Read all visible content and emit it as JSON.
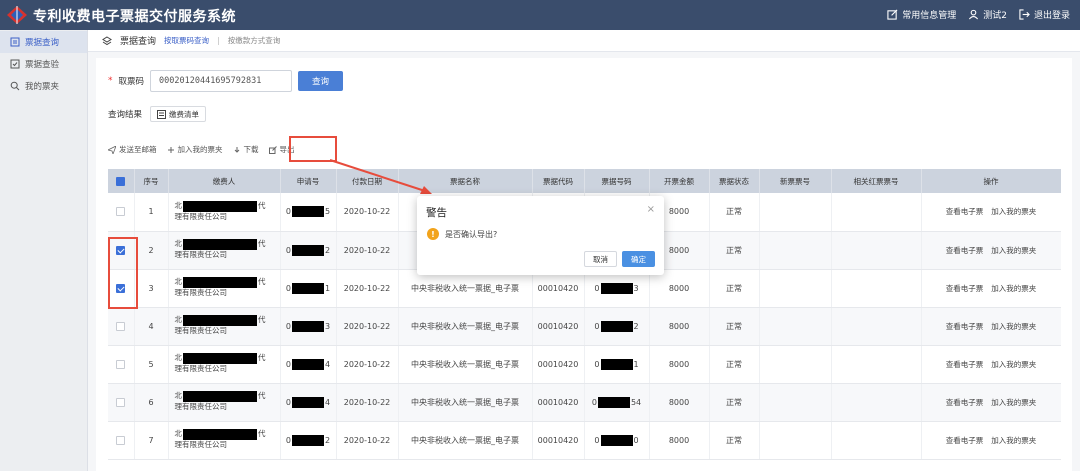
{
  "app": {
    "title": "专利收费电子票据交付服务系统"
  },
  "topbar": {
    "actions": [
      {
        "label": "常用信息管理",
        "icon": "edit-icon"
      },
      {
        "label": "测试2",
        "icon": "user-icon"
      },
      {
        "label": "退出登录",
        "icon": "logout-icon"
      }
    ]
  },
  "sidebar": {
    "items": [
      {
        "label": "票据查询",
        "icon": "document-icon",
        "active": true
      },
      {
        "label": "票据查验",
        "icon": "check-icon",
        "active": false
      },
      {
        "label": "我的票夹",
        "icon": "search-icon",
        "active": false
      }
    ]
  },
  "breadcrumb": {
    "main": "票据查询",
    "tabs": [
      "按取票码查询",
      "按缴款方式查询"
    ],
    "separator": "|"
  },
  "search": {
    "required_mark": "*",
    "label": "取票码",
    "value": "00020120441695792831",
    "button": "查询"
  },
  "result": {
    "label": "查询结果",
    "bill_button": "缴费清单"
  },
  "toolbar": {
    "send_email": "发送至邮箱",
    "add_folder": "加入我的票夹",
    "download": "下载",
    "export": "导出"
  },
  "table": {
    "headers": [
      "序号",
      "缴费人",
      "申请号",
      "付款日期",
      "票据名称",
      "票据代码",
      "票据号码",
      "开票金额",
      "票据状态",
      "新票票号",
      "相关红票票号",
      "操作"
    ],
    "rows": [
      {
        "checked": false,
        "no": "1",
        "payer_prefix": "北",
        "payer_suffix": "代",
        "payer_line2": "理有限责任公司",
        "app_prefix": "0",
        "app_suffix": "5",
        "date": "2020-10-22",
        "name": "",
        "code": "",
        "num_prefix": "",
        "num_suffix": "",
        "amount": "8000",
        "status": "正常",
        "op_view": "查看电子票",
        "op_add": "加入我的票夹"
      },
      {
        "checked": true,
        "no": "2",
        "payer_prefix": "北",
        "payer_suffix": "代",
        "payer_line2": "理有限责任公司",
        "app_prefix": "0",
        "app_suffix": "2",
        "date": "2020-10-22",
        "name": "",
        "code": "",
        "num_prefix": "",
        "num_suffix": "",
        "amount": "8000",
        "status": "正常",
        "op_view": "查看电子票",
        "op_add": "加入我的票夹"
      },
      {
        "checked": true,
        "no": "3",
        "payer_prefix": "北",
        "payer_suffix": "代",
        "payer_line2": "理有限责任公司",
        "app_prefix": "0",
        "app_suffix": "1",
        "date": "2020-10-22",
        "name": "中央非税收入统一票据_电子票",
        "code": "00010420",
        "num_prefix": "0",
        "num_suffix": "3",
        "amount": "8000",
        "status": "正常",
        "op_view": "查看电子票",
        "op_add": "加入我的票夹"
      },
      {
        "checked": false,
        "no": "4",
        "payer_prefix": "北",
        "payer_suffix": "代",
        "payer_line2": "理有限责任公司",
        "app_prefix": "0",
        "app_suffix": "3",
        "date": "2020-10-22",
        "name": "中央非税收入统一票据_电子票",
        "code": "00010420",
        "num_prefix": "0",
        "num_suffix": "2",
        "amount": "8000",
        "status": "正常",
        "op_view": "查看电子票",
        "op_add": "加入我的票夹"
      },
      {
        "checked": false,
        "no": "5",
        "payer_prefix": "北",
        "payer_suffix": "代",
        "payer_line2": "理有限责任公司",
        "app_prefix": "0",
        "app_suffix": "4",
        "date": "2020-10-22",
        "name": "中央非税收入统一票据_电子票",
        "code": "00010420",
        "num_prefix": "0",
        "num_suffix": "1",
        "amount": "8000",
        "status": "正常",
        "op_view": "查看电子票",
        "op_add": "加入我的票夹"
      },
      {
        "checked": false,
        "no": "6",
        "payer_prefix": "北",
        "payer_suffix": "代",
        "payer_line2": "理有限责任公司",
        "app_prefix": "0",
        "app_suffix": "4",
        "date": "2020-10-22",
        "name": "中央非税收入统一票据_电子票",
        "code": "00010420",
        "num_prefix": "0",
        "num_suffix": "54",
        "amount": "8000",
        "status": "正常",
        "op_view": "查看电子票",
        "op_add": "加入我的票夹"
      },
      {
        "checked": false,
        "no": "7",
        "payer_prefix": "北",
        "payer_suffix": "代",
        "payer_line2": "理有限责任公司",
        "app_prefix": "0",
        "app_suffix": "2",
        "date": "2020-10-22",
        "name": "中央非税收入统一票据_电子票",
        "code": "00010420",
        "num_prefix": "0",
        "num_suffix": "0",
        "amount": "8000",
        "status": "正常",
        "op_view": "查看电子票",
        "op_add": "加入我的票夹"
      }
    ]
  },
  "modal": {
    "title": "警告",
    "close": "×",
    "icon": "!",
    "message": "是否确认导出?",
    "cancel": "取消",
    "confirm": "确定"
  },
  "colors": {
    "topbar": "#3a4d6c",
    "primary": "#4a7fd6",
    "highlight": "#e74c3c",
    "warning": "#f2a31b"
  }
}
